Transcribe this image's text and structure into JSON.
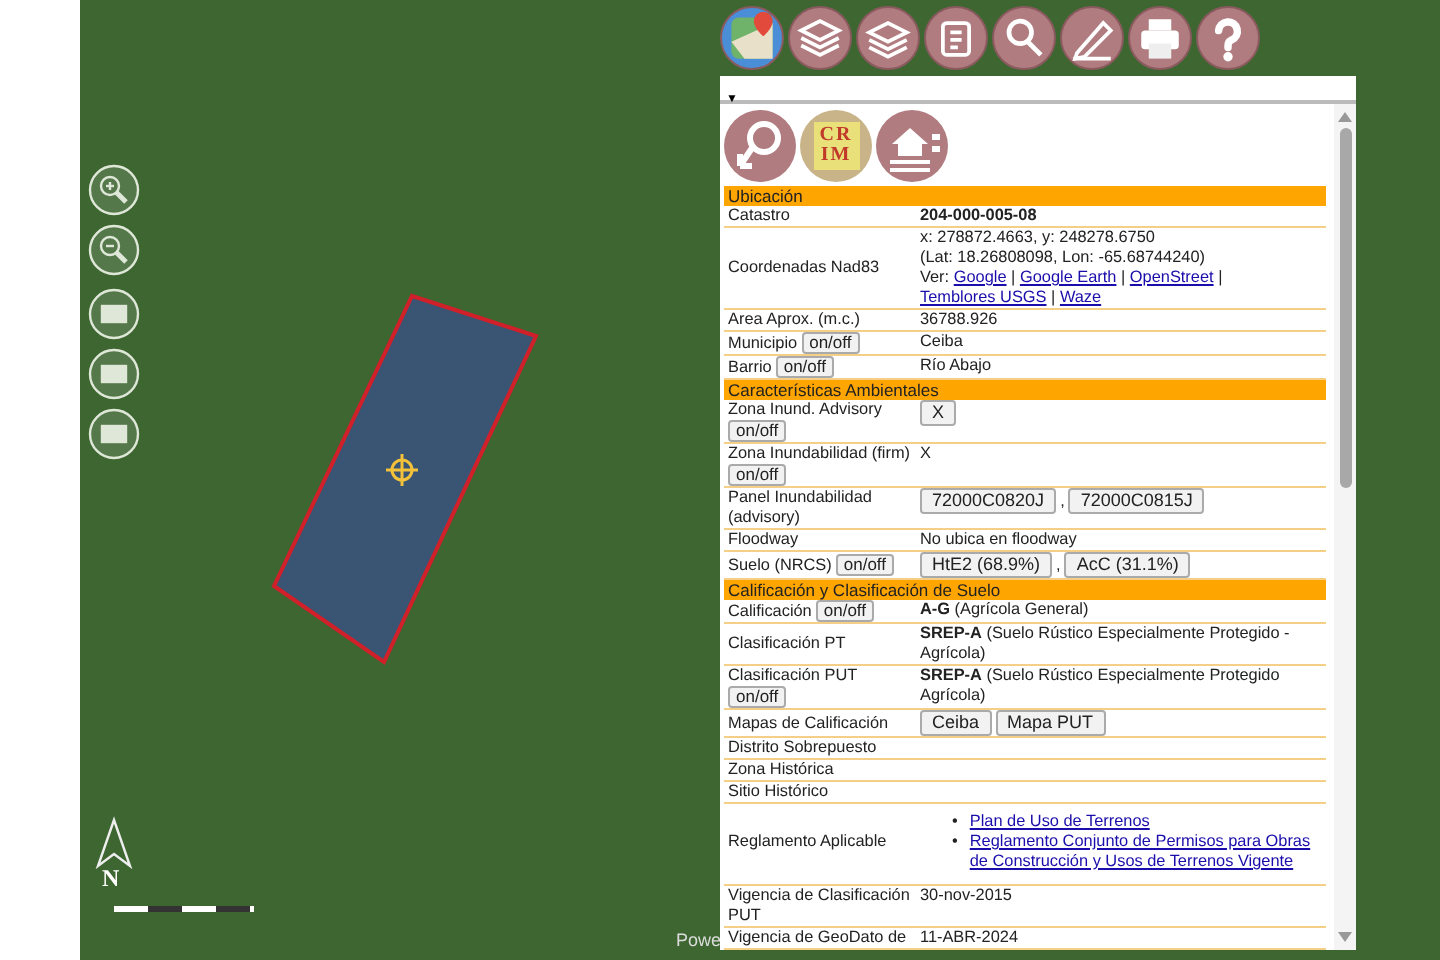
{
  "map": {
    "north_label": "N",
    "attribution": "Powe"
  },
  "panel": {
    "menu_toggle": "▼",
    "logo_text": "CRIM",
    "rows": [
      {
        "kind": "section",
        "label": "Ubicación"
      },
      {
        "kind": "field",
        "label": "Catastro",
        "value": {
          "kind": "text",
          "strong": true,
          "text": "204-000-005-08"
        }
      },
      {
        "kind": "field",
        "label": "Coordenadas Nad83",
        "value": {
          "kind": "coords",
          "lines": [
            "x: 278872.4663, y: 248278.6750",
            "(Lat: 18.26808098, Lon: -65.68744240)"
          ],
          "prefix": "Ver:",
          "separator": "|",
          "links": [
            "Google",
            "Google Earth",
            "OpenStreet",
            "Temblores USGS",
            "Waze"
          ]
        }
      },
      {
        "kind": "field",
        "label": "Area Aprox. (m.c.)",
        "value": {
          "kind": "text",
          "text": "36788.926"
        }
      },
      {
        "kind": "field",
        "label": "Municipio",
        "toggle": "on/off",
        "value": {
          "kind": "text",
          "text": "Ceiba"
        }
      },
      {
        "kind": "field",
        "label": "Barrio",
        "toggle": "on/off",
        "value": {
          "kind": "text",
          "text": "Río Abajo"
        }
      },
      {
        "kind": "section",
        "label": "Características Ambientales"
      },
      {
        "kind": "field",
        "label": "Zona Inund. Advisory",
        "toggle": "on/off",
        "value": {
          "kind": "buttons",
          "buttons": [
            "X"
          ]
        }
      },
      {
        "kind": "field",
        "label": "Zona Inundabilidad (firm)",
        "toggle": "on/off",
        "value": {
          "kind": "text",
          "text": "X"
        }
      },
      {
        "kind": "field",
        "label": "Panel Inundabilidad (advisory)",
        "value": {
          "kind": "buttons",
          "separator": ",",
          "buttons": [
            "72000C0820J",
            "72000C0815J"
          ]
        }
      },
      {
        "kind": "field",
        "label": "Floodway",
        "value": {
          "kind": "text",
          "text": "No ubica en floodway"
        }
      },
      {
        "kind": "field",
        "label": "Suelo (NRCS)",
        "toggle": "on/off",
        "value": {
          "kind": "buttons",
          "separator": ",",
          "buttons": [
            "HtE2 (68.9%)",
            "AcC (31.1%)"
          ]
        }
      },
      {
        "kind": "section",
        "label": "Calificación y Clasificación de Suelo"
      },
      {
        "kind": "field",
        "label": "Calificación",
        "toggle": "on/off",
        "value": {
          "kind": "text",
          "text": "**A-G** (Agrícola General)"
        }
      },
      {
        "kind": "field",
        "label": "Clasificación PT",
        "value": {
          "kind": "text",
          "text": "**SREP-A** (Suelo Rústico Especialmente Protegido - Agrícola)"
        }
      },
      {
        "kind": "field",
        "label": "Clasificación PUT",
        "toggle": "on/off",
        "value": {
          "kind": "text",
          "text": "**SREP-A** (Suelo Rústico Especialmente Protegido Agrícola)"
        }
      },
      {
        "kind": "field",
        "label": "Mapas de Calificación",
        "value": {
          "kind": "buttons",
          "buttons": [
            "Ceiba",
            "Mapa PUT"
          ]
        }
      },
      {
        "kind": "field",
        "label": "Distrito Sobrepuesto"
      },
      {
        "kind": "field",
        "label": "Zona Histórica"
      },
      {
        "kind": "field",
        "label": "Sitio Histórico"
      },
      {
        "kind": "field",
        "label": "Reglamento Aplicable",
        "value": {
          "kind": "bullets",
          "marker": "•",
          "links": [
            "Plan de Uso de Terrenos",
            "Reglamento Conjunto de Permisos para Obras de Construcción y Usos de Terrenos Vigente"
          ]
        }
      },
      {
        "kind": "field",
        "label": "Vigencia de Clasificación PUT",
        "value": {
          "kind": "text",
          "text": "30-nov-2015"
        }
      },
      {
        "kind": "field",
        "label": "Vigencia de GeoDato de",
        "value": {
          "kind": "text",
          "text": "11-ABR-2024"
        }
      }
    ]
  }
}
